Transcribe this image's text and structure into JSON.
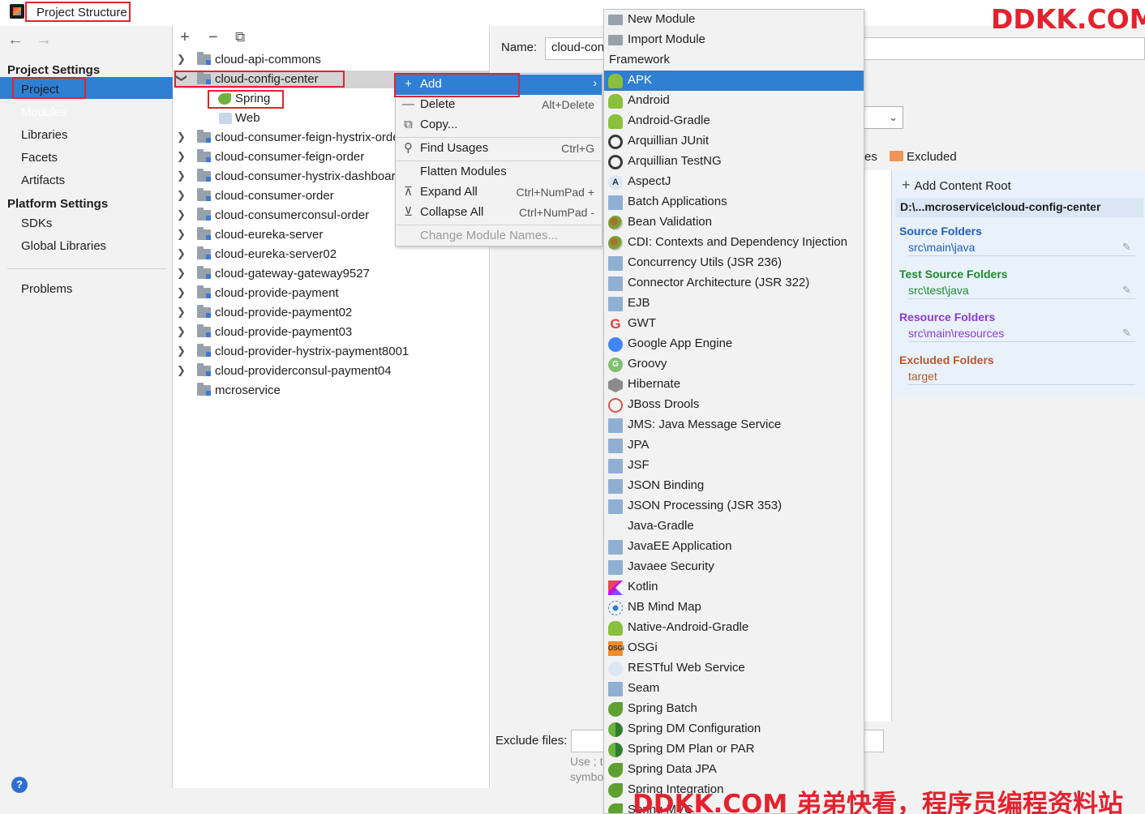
{
  "window": {
    "title": "Project Structure"
  },
  "watermark": {
    "top": "DDKK.COM",
    "bottom": "DDKK.COM 弟弟快看，程序员编程资料站"
  },
  "sidebar": {
    "project_settings": "Project Settings",
    "items_ps": [
      "Project",
      "Modules",
      "Libraries",
      "Facets",
      "Artifacts"
    ],
    "platform_settings": "Platform Settings",
    "items_plat": [
      "SDKs",
      "Global Libraries"
    ],
    "problems": "Problems",
    "selected": "Modules"
  },
  "tree": {
    "toolbar": {
      "add": "+",
      "remove": "−",
      "copy": "⧉"
    },
    "rows": [
      "cloud-api-commons",
      "cloud-config-center",
      "Spring",
      "Web",
      "cloud-consumer-feign-hystrix-order",
      "cloud-consumer-feign-order",
      "cloud-consumer-hystrix-dashboard",
      "cloud-consumer-order",
      "cloud-consumerconsul-order",
      "cloud-eureka-server",
      "cloud-eureka-server02",
      "cloud-gateway-gateway9527",
      "cloud-provide-payment",
      "cloud-provide-payment02",
      "cloud-provide-payment03",
      "cloud-provider-hystrix-payment8001",
      "cloud-providerconsul-payment04",
      "mcroservice"
    ]
  },
  "details": {
    "name_label": "Name:",
    "name_value": "cloud-config-center",
    "es_fragment": "es",
    "excluded_label": "Excluded",
    "add_content_root": "Add Content Root",
    "root_path": "D:\\...mcroservice\\cloud-config-center",
    "source_folders": "Source Folders",
    "source_path": "src\\main\\java",
    "test_folders": "Test Source Folders",
    "test_path": "src\\test\\java",
    "resource_folders": "Resource Folders",
    "resource_path": "src\\main\\resources",
    "excluded_folders": "Excluded Folders",
    "excluded_path": "target",
    "exclude_files_label": "Exclude files:",
    "exclude_hint_1": "Use ; t",
    "exclude_hint_2": "symbo",
    "colors": {
      "source": "#1f5fc0",
      "test": "#1d8a2c",
      "resource": "#8a3bd1",
      "excluded": "#b8582a"
    }
  },
  "context_menu": {
    "add": "Add",
    "delete": "Delete",
    "delete_shortcut": "Alt+Delete",
    "copy": "Copy...",
    "find_usages": "Find Usages",
    "find_shortcut": "Ctrl+G",
    "flatten": "Flatten Modules",
    "expand_all": "Expand All",
    "expand_shortcut": "Ctrl+NumPad +",
    "collapse_all": "Collapse All",
    "collapse_shortcut": "Ctrl+NumPad -",
    "change_names": "Change Module Names..."
  },
  "submenu": {
    "new_module": "New Module",
    "import_module": "Import Module",
    "framework_header": "Framework",
    "frameworks": [
      {
        "label": "APK",
        "icon": "android-icon"
      },
      {
        "label": "Android",
        "icon": "android-icon"
      },
      {
        "label": "Android-Gradle",
        "icon": "android-icon"
      },
      {
        "label": "Arquillian JUnit",
        "icon": "arquillian-icon"
      },
      {
        "label": "Arquillian TestNG",
        "icon": "arquillian-icon"
      },
      {
        "label": "AspectJ",
        "icon": "aspectj-icon"
      },
      {
        "label": "Batch Applications",
        "icon": "batch-icon"
      },
      {
        "label": "Bean Validation",
        "icon": "bean-validation-icon"
      },
      {
        "label": "CDI: Contexts and Dependency Injection",
        "icon": "cdi-icon"
      },
      {
        "label": "Concurrency Utils (JSR 236)",
        "icon": "concurrency-icon"
      },
      {
        "label": "Connector Architecture (JSR 322)",
        "icon": "connector-icon"
      },
      {
        "label": "EJB",
        "icon": "ejb-icon"
      },
      {
        "label": "GWT",
        "icon": "google-icon"
      },
      {
        "label": "Google App Engine",
        "icon": "app-engine-icon"
      },
      {
        "label": "Groovy",
        "icon": "groovy-icon"
      },
      {
        "label": "Hibernate",
        "icon": "hibernate-icon"
      },
      {
        "label": "JBoss Drools",
        "icon": "drools-icon"
      },
      {
        "label": "JMS: Java Message Service",
        "icon": "jms-icon"
      },
      {
        "label": "JPA",
        "icon": "jpa-icon"
      },
      {
        "label": "JSF",
        "icon": "jsf-icon"
      },
      {
        "label": "JSON Binding",
        "icon": "json-icon"
      },
      {
        "label": "JSON Processing (JSR 353)",
        "icon": "json-icon"
      },
      {
        "label": "Java-Gradle",
        "icon": ""
      },
      {
        "label": "JavaEE Application",
        "icon": "javaee-icon"
      },
      {
        "label": "Javaee Security",
        "icon": "security-icon"
      },
      {
        "label": "Kotlin",
        "icon": "kotlin-icon"
      },
      {
        "label": "NB Mind Map",
        "icon": "mind-map-icon"
      },
      {
        "label": "Native-Android-Gradle",
        "icon": "android-icon"
      },
      {
        "label": "OSGi",
        "icon": "osgi-icon"
      },
      {
        "label": "RESTful Web Service",
        "icon": "rest-icon"
      },
      {
        "label": "Seam",
        "icon": "seam-icon"
      },
      {
        "label": "Spring Batch",
        "icon": "spring-batch-icon"
      },
      {
        "label": "Spring DM Configuration",
        "icon": "spring-dm-icon"
      },
      {
        "label": "Spring DM Plan or PAR",
        "icon": "spring-dm-icon"
      },
      {
        "label": "Spring Data JPA",
        "icon": "spring-data-icon"
      },
      {
        "label": "Spring Integration",
        "icon": "spring-integration-icon"
      },
      {
        "label": "Spring MVC",
        "icon": "spring-mvc-icon"
      }
    ]
  }
}
